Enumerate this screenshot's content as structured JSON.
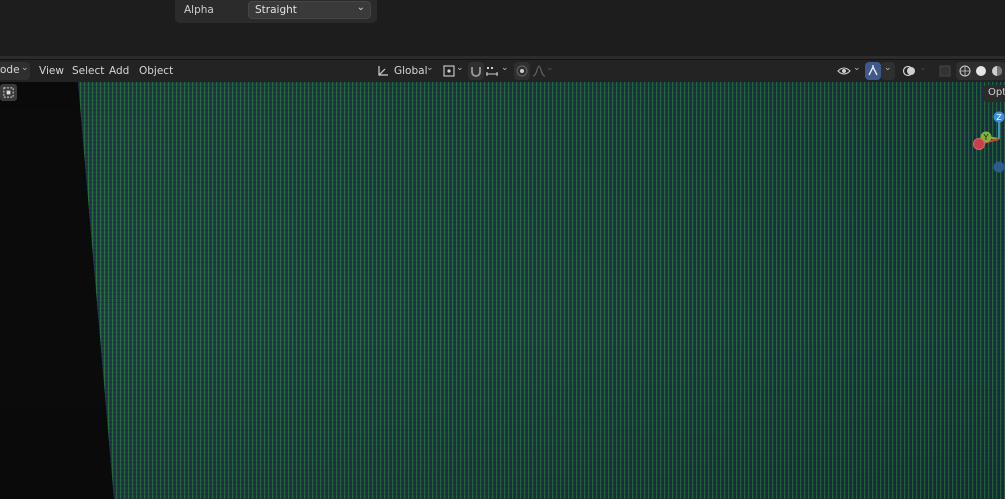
{
  "panel": {
    "alpha_label": "Alpha",
    "alpha_value": "Straight"
  },
  "header": {
    "mode_label": "ode",
    "menu_view": "View",
    "menu_select": "Select",
    "menu_add": "Add",
    "menu_object": "Object",
    "orientation_label": "Global"
  },
  "viewport": {
    "options_label": "Opti",
    "gizmo_z": "Z",
    "gizmo_y": "Y"
  },
  "colors": {
    "accent": "#3d5a8a",
    "axis_x": "#c8404a",
    "axis_y": "#7fb33a",
    "axis_z": "#3c8fe0"
  }
}
